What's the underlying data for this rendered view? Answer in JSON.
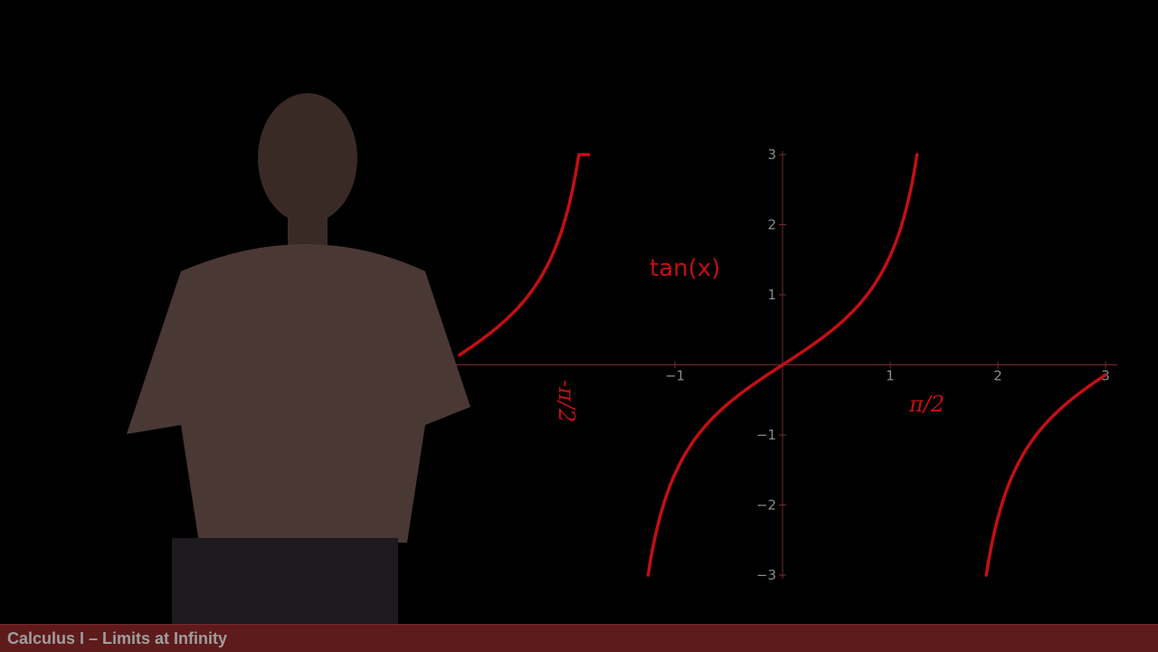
{
  "colors": {
    "curve": "#c40f12",
    "axis": "#7a2a2a",
    "tick_text": "#8a8a8a",
    "footer_bg": "#5e1b1b",
    "footer_text": "#9e9e9e"
  },
  "footer": {
    "title": "Calculus I – Limits at Infinity"
  },
  "handwritten": {
    "neg_half_pi": "-π/2",
    "pos_half_pi": "π/2"
  },
  "chart_data": {
    "type": "line",
    "function": "tan(x)",
    "function_label": "tan(x)",
    "xlim": [
      -1.6,
      3.0
    ],
    "ylim": [
      -3,
      3
    ],
    "x_ticks": [
      -1,
      1,
      2,
      3
    ],
    "x_tick_labels": [
      "−1",
      "1",
      "2",
      "3"
    ],
    "y_ticks": [
      -3,
      -2,
      -1,
      1,
      2,
      3
    ],
    "y_tick_labels": [
      "−3",
      "−2",
      "−1",
      "1",
      "2",
      "3"
    ],
    "asymptotes": [
      -1.5708,
      1.5708
    ],
    "branches": [
      {
        "x_from": -3.0,
        "x_to": -1.8
      },
      {
        "x_from": -1.249,
        "x_to": 1.249
      },
      {
        "x_from": 1.892,
        "x_to": 3.0
      }
    ],
    "grid": false,
    "legend": "none"
  }
}
